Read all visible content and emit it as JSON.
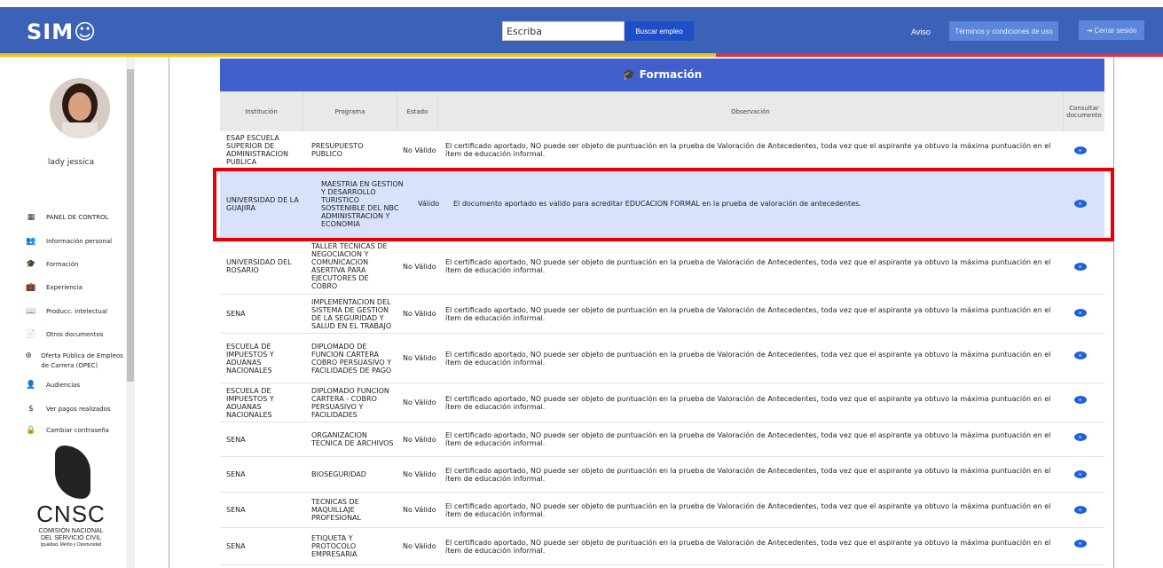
{
  "header": {
    "logo": "SIM☺",
    "search_value": "Escriba",
    "search_button": "Buscar empleo",
    "aviso": "Aviso",
    "terms_button": "Términos y condiciones de uso",
    "logout_button": "⇥ Cerrar sesión"
  },
  "sidebar": {
    "user_name": "lady jessica",
    "items": [
      {
        "icon": "▦",
        "label": "PANEL DE CONTROL"
      },
      {
        "icon": "👥",
        "label": "Información personal"
      },
      {
        "icon": "🎓",
        "label": "Formación"
      },
      {
        "icon": "💼",
        "label": "Experiencia"
      },
      {
        "icon": "📖",
        "label": "Producc. intelectual"
      },
      {
        "icon": "📄",
        "label": "Otros documentos"
      },
      {
        "icon": "⊛",
        "label": "Oferta Pública de Empleos de Carrera (OPEC)"
      },
      {
        "icon": "👤",
        "label": "Audiencias"
      },
      {
        "icon": "$",
        "label": "Ver pagos realizados"
      },
      {
        "icon": "🔒",
        "label": "Cambiar contraseña"
      }
    ],
    "cnsc": {
      "name": "CNSC",
      "line1": "COMISIÓN NACIONAL",
      "line2": "DEL SERVICIO CIVIL",
      "tagline": "Igualdad, Mérito y Oportunidad"
    }
  },
  "section": {
    "title": "🎓 Formación"
  },
  "table": {
    "headers": {
      "institucion": "Institución",
      "programa": "Programa",
      "estado": "Estado",
      "observacion": "Observación",
      "consultar": "Consultar documento"
    },
    "rows": [
      {
        "institucion": "ESAP ESCUELA SUPERIOR DE ADMINISTRACION PUBLICA",
        "programa": "PRESUPUESTO PUBLICO",
        "estado": "No Válido",
        "observacion": "El certificado aportado, NO puede ser objeto de puntuación en la prueba de Valoración de Antecedentes, toda vez que el aspirante ya obtuvo la máxima puntuación en el ítem de educación informal."
      },
      {
        "institucion": "UNIVERSIDAD DE LA GUAJIRA",
        "programa": "MAESTRIA EN GESTION Y DESARROLLO TURISTICO SOSTENIBLE DEL NBC ADMINISTRACION Y ECONOMIA",
        "estado": "Válido",
        "observacion": "El documento aportado es valido para acreditar EDUCACION FORMAL en la prueba de valoración de antecedentes."
      },
      {
        "institucion": "UNIVERSIDAD DEL ROSARIO",
        "programa": "TALLER TECNICAS DE NEGOCIACION Y COMUNICACION ASERTIVA PARA EJECUTORES DE COBRO",
        "estado": "No Válido",
        "observacion": "El certificado aportado, NO puede ser objeto de puntuación en la prueba de Valoración de Antecedentes, toda vez que el aspirante ya obtuvo la máxima puntuación en el ítem de educación informal."
      },
      {
        "institucion": "SENA",
        "programa": "IMPLEMENTACION DEL SISTEMA DE GESTION DE LA SEGURIDAD Y SALUD EN EL TRABAJO",
        "estado": "No Válido",
        "observacion": "El certificado aportado, NO puede ser objeto de puntuación en la prueba de Valoración de Antecedentes, toda vez que el aspirante ya obtuvo la máxima puntuación en el ítem de educación informal."
      },
      {
        "institucion": "ESCUELA DE IMPUESTOS Y ADUANAS NACIONALES",
        "programa": "DIPLOMADO DE FUNCION CARTERA COBRO PERSUASIVO Y FACILIDADES DE PAGO",
        "estado": "No Válido",
        "observacion": "El certificado aportado, NO puede ser objeto de puntuación en la prueba de Valoración de Antecedentes, toda vez que el aspirante ya obtuvo la máxima puntuación en el ítem de educación informal."
      },
      {
        "institucion": "ESCUELA DE IMPUESTOS Y ADUANAS NACIONALES",
        "programa": "DIPLOMADO FUNCION CARTERA - COBRO PERSUASIVO Y FACILIDADES",
        "estado": "No Válido",
        "observacion": "El certificado aportado, NO puede ser objeto de puntuación en la prueba de Valoración de Antecedentes, toda vez que el aspirante ya obtuvo la máxima puntuación en el ítem de educación informal."
      },
      {
        "institucion": "SENA",
        "programa": "ORGANIZACION TECNICA DE ARCHIVOS",
        "estado": "No Válido",
        "observacion": "El certificado aportado, NO puede ser objeto de puntuación en la prueba de Valoración de Antecedentes, toda vez que el aspirante ya obtuvo la máxima puntuación en el ítem de educación informal."
      },
      {
        "institucion": "SENA",
        "programa": "BIOSEGURIDAD",
        "estado": "No Válido",
        "observacion": "El certificado aportado, NO puede ser objeto de puntuación en la prueba de Valoración de Antecedentes, toda vez que el aspirante ya obtuvo la máxima puntuación en el ítem de educación informal."
      },
      {
        "institucion": "SENA",
        "programa": "TECNICAS DE MAQUILLAJE PROFESIONAL",
        "estado": "No Válido",
        "observacion": "El certificado aportado, NO puede ser objeto de puntuación en la prueba de Valoración de Antecedentes, toda vez que el aspirante ya obtuvo la máxima puntuación en el ítem de educación informal."
      },
      {
        "institucion": "SENA",
        "programa": "ETIQUETA Y PROTOCOLO EMPRESARIA",
        "estado": "No Válido",
        "observacion": "El certificado aportado, NO puede ser objeto de puntuación en la prueba de Valoración de Antecedentes, toda vez que el aspirante ya obtuvo la máxima puntuación en el ítem de educación informal."
      }
    ]
  },
  "colors": {
    "header_bg": "#3b62b7",
    "section_bg": "#4160cd",
    "highlight_row": "#d9e2fb",
    "annotation_box": "#e80000",
    "eye_icon": "#1d5fd6"
  }
}
